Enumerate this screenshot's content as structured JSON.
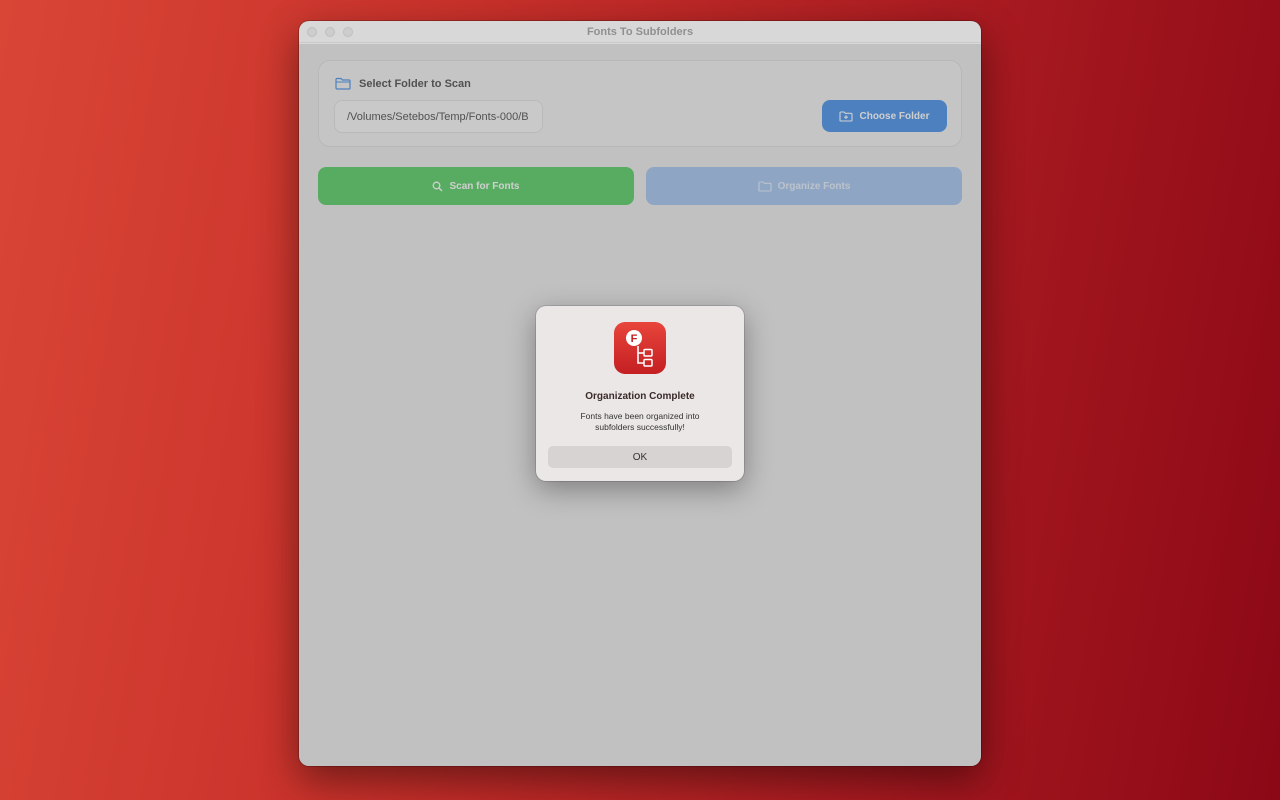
{
  "window": {
    "title": "Fonts To Subfolders"
  },
  "folder_panel": {
    "heading": "Select Folder to Scan",
    "path_value": "/Volumes/Setebos/Temp/Fonts-000/B",
    "choose_button": "Choose Folder"
  },
  "actions": {
    "scan_label": "Scan for Fonts",
    "organize_label": "Organize Fonts"
  },
  "dialog": {
    "title": "Organization Complete",
    "message_line1": "Fonts have been organized into",
    "message_line2": "subfolders successfully!",
    "ok_label": "OK",
    "icon_letter": "F"
  },
  "colors": {
    "accent_blue": "#4f95ea",
    "scan_green": "#5fd06d",
    "organize_disabled": "#a8c8ef",
    "app_icon_red": "#d92c2a"
  },
  "icons": {
    "folder_heading": "folder-icon",
    "choose": "folder-plus-icon",
    "scan": "search-icon",
    "organize": "folder-arrow-icon",
    "app": "fonts-to-subfolders-app-icon"
  }
}
